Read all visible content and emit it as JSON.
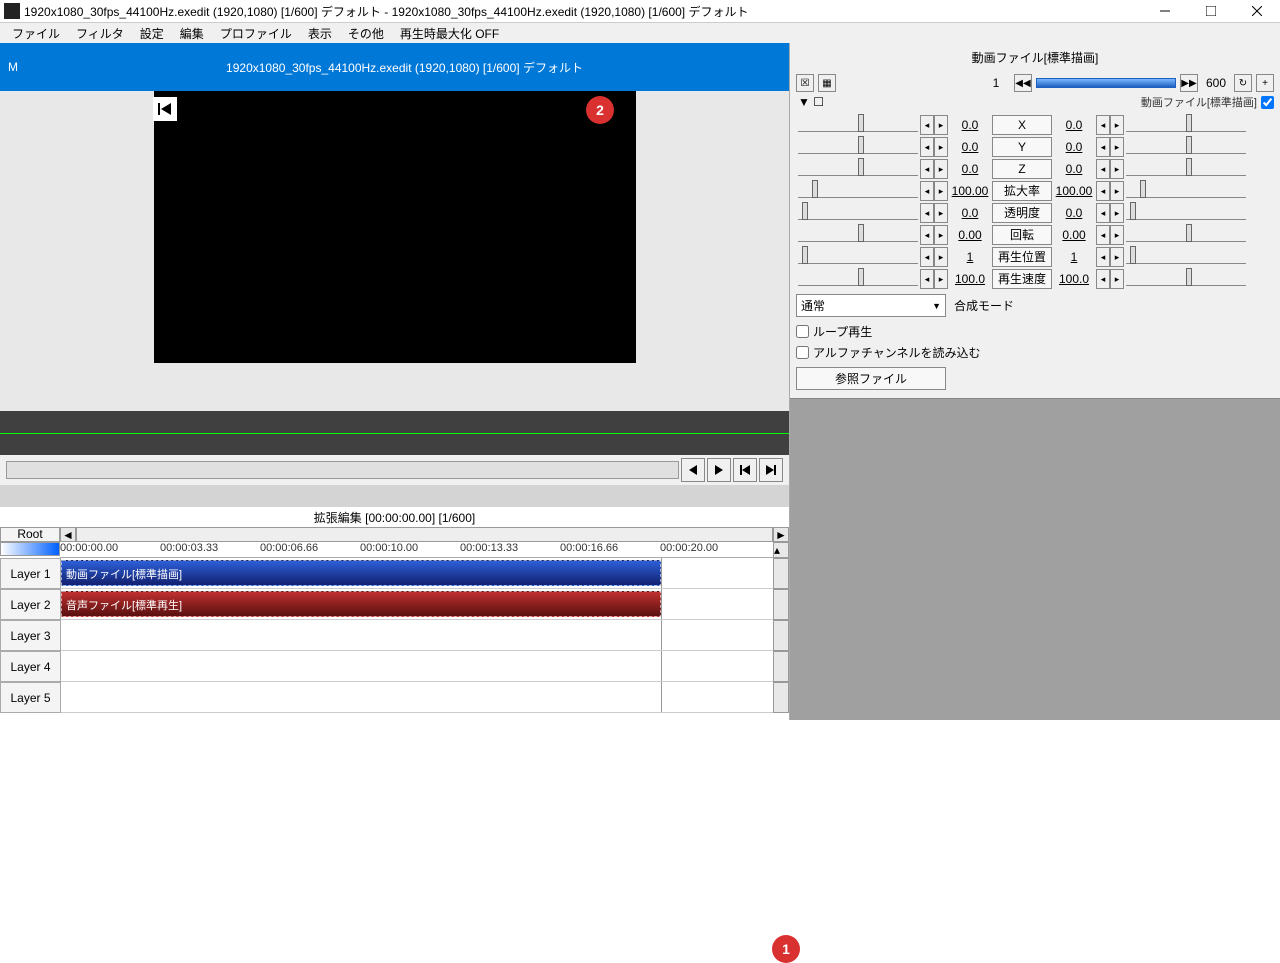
{
  "titlebar": {
    "text": "1920x1080_30fps_44100Hz.exedit (1920,1080)  [1/600]  デフォルト - 1920x1080_30fps_44100Hz.exedit (1920,1080)  [1/600]  デフォルト"
  },
  "menu": {
    "file": "ファイル",
    "filter": "フィルタ",
    "settings": "設定",
    "edit": "編集",
    "profile": "プロファイル",
    "view": "表示",
    "other": "その他",
    "playmax": "再生時最大化 OFF"
  },
  "preview": {
    "m": "M",
    "info": "1920x1080_30fps_44100Hz.exedit (1920,1080)  [1/600]  デフォルト"
  },
  "timeline": {
    "title": "拡張編集 [00:00:00.00] [1/600]",
    "root": "Root",
    "ticks": [
      "00:00:00.00",
      "00:00:03.33",
      "00:00:06.66",
      "00:00:10.00",
      "00:00:13.33",
      "00:00:16.66",
      "00:00:20.00"
    ],
    "layers": [
      "Layer 1",
      "Layer 2",
      "Layer 3",
      "Layer 4",
      "Layer 5"
    ],
    "clip_video": "動画ファイル[標準描画]",
    "clip_audio": "音声ファイル[標準再生]"
  },
  "panel": {
    "title": "動画ファイル[標準描画]",
    "frame_start": "1",
    "frame_end": "600",
    "obj_type_label": "動画ファイル[標準描画]",
    "params": [
      {
        "name": "X",
        "left": "0.0",
        "right": "0.0",
        "thumb": 50
      },
      {
        "name": "Y",
        "left": "0.0",
        "right": "0.0",
        "thumb": 50
      },
      {
        "name": "Z",
        "left": "0.0",
        "right": "0.0",
        "thumb": 50
      },
      {
        "name": "拡大率",
        "left": "100.00",
        "right": "100.00",
        "thumb": 12
      },
      {
        "name": "透明度",
        "left": "0.0",
        "right": "0.0",
        "thumb": 3
      },
      {
        "name": "回転",
        "left": "0.00",
        "right": "0.00",
        "thumb": 50
      },
      {
        "name": "再生位置",
        "left": "1",
        "right": "1",
        "thumb": 3
      },
      {
        "name": "再生速度",
        "left": "100.0",
        "right": "100.0",
        "thumb": 50
      }
    ],
    "combo": "通常",
    "combo_label": "合成モード",
    "loop": "ループ再生",
    "alpha": "アルファチャンネルを読み込む",
    "ref": "参照ファイル"
  },
  "badges": {
    "b1": "1",
    "b2": "2"
  }
}
